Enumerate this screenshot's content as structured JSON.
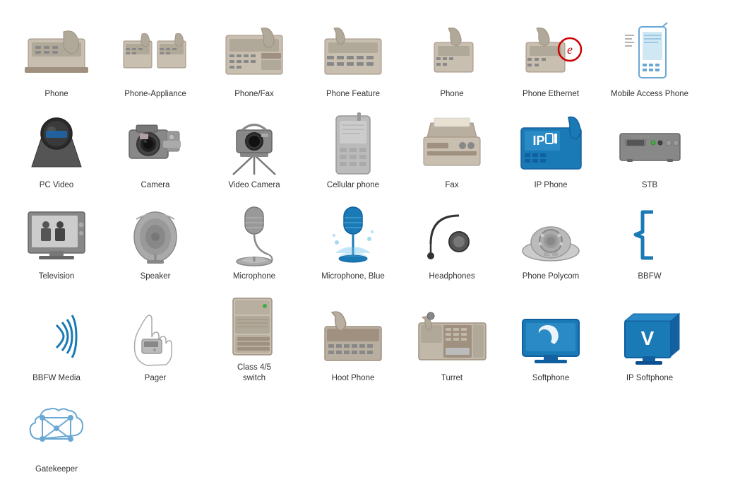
{
  "items": [
    {
      "id": "phone",
      "label": "Phone",
      "row": 1
    },
    {
      "id": "phone-appliance",
      "label": "Phone-Appliance",
      "row": 1
    },
    {
      "id": "phone-fax",
      "label": "Phone/Fax",
      "row": 1
    },
    {
      "id": "phone-feature",
      "label": "Phone Feature",
      "row": 1
    },
    {
      "id": "phone2",
      "label": "Phone",
      "row": 1
    },
    {
      "id": "phone-ethernet",
      "label": "Phone Ethernet",
      "row": 1
    },
    {
      "id": "mobile-access-phone",
      "label": "Mobile Access Phone",
      "row": 1
    },
    {
      "id": "pc-video",
      "label": "PC Video",
      "row": 2
    },
    {
      "id": "camera",
      "label": "Camera",
      "row": 2
    },
    {
      "id": "video-camera",
      "label": "Video Camera",
      "row": 2
    },
    {
      "id": "cellular-phone",
      "label": "Cellular phone",
      "row": 2
    },
    {
      "id": "fax",
      "label": "Fax",
      "row": 2
    },
    {
      "id": "ip-phone",
      "label": "IP Phone",
      "row": 2
    },
    {
      "id": "stb",
      "label": "STB",
      "row": 2
    },
    {
      "id": "television",
      "label": "Television",
      "row": 3
    },
    {
      "id": "speaker",
      "label": "Speaker",
      "row": 3
    },
    {
      "id": "microphone",
      "label": "Microphone",
      "row": 3
    },
    {
      "id": "microphone-blue",
      "label": "Microphone, Blue",
      "row": 3
    },
    {
      "id": "headphones",
      "label": "Headphones",
      "row": 3
    },
    {
      "id": "phone-polycom",
      "label": "Phone Polycom",
      "row": 3
    },
    {
      "id": "bbfw",
      "label": "BBFW",
      "row": 3
    },
    {
      "id": "bbfw-media",
      "label": "BBFW Media",
      "row": 3
    },
    {
      "id": "pager",
      "label": "Pager",
      "row": 4
    },
    {
      "id": "class-switch",
      "label": "Class 4/5\nswitch",
      "row": 4
    },
    {
      "id": "hoot-phone",
      "label": "Hoot Phone",
      "row": 4
    },
    {
      "id": "turret",
      "label": "Turret",
      "row": 4
    },
    {
      "id": "softphone",
      "label": "Softphone",
      "row": 4
    },
    {
      "id": "ip-softphone",
      "label": "IP Softphone",
      "row": 4
    },
    {
      "id": "gatekeeper",
      "label": "Gatekeeper",
      "row": 4
    }
  ]
}
